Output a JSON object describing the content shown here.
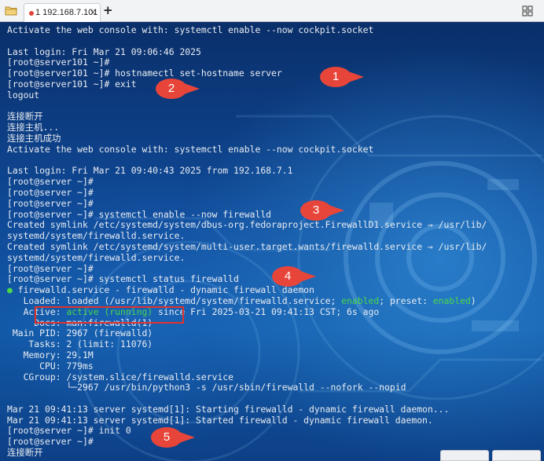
{
  "tabs": [
    {
      "label": "1 192.168.7.101",
      "active": true,
      "close": "×"
    }
  ],
  "new_tab": "+",
  "colors": {
    "accent_red": "#e2322a",
    "terminal_text": "#e8ecf2",
    "status_green": "#4bd84b",
    "terminal_bg": "#0f4a98"
  },
  "icons": [
    "folder-icon",
    "tab-status-dot-icon",
    "close-icon",
    "plus-icon",
    "grid-icon",
    "status-dot-icon"
  ],
  "terminal": {
    "lines": [
      "Activate the web console with: systemctl enable --now cockpit.socket",
      "",
      "Last login: Fri Mar 21 09:06:46 2025",
      "[root@server101 ~]#",
      "[root@server101 ~]# hostnamectl set-hostname server",
      "[root@server101 ~]# exit",
      "logout",
      "",
      "连接断开",
      "连接主机...",
      "连接主机成功",
      "Activate the web console with: systemctl enable --now cockpit.socket",
      "",
      "Last login: Fri Mar 21 09:40:43 2025 from 192.168.7.1",
      "[root@server ~]#",
      "[root@server ~]#",
      "[root@server ~]#",
      "[root@server ~]# systemctl enable --now firewalld",
      "Created symlink /etc/systemd/system/dbus-org.fedoraproject.FirewallD1.service → /usr/lib/",
      "systemd/system/firewalld.service.",
      "Created symlink /etc/systemd/system/multi-user.target.wants/firewalld.service → /usr/lib/",
      "systemd/system/firewalld.service.",
      "[root@server ~]#",
      "[root@server ~]# systemctl status firewalld"
    ],
    "status_title": "firewalld.service - firewalld - dynamic firewall daemon",
    "status_bullet": "●",
    "loaded_prefix": "   Loaded: loaded (/usr/lib/systemd/system/firewalld.service; ",
    "loaded_enabled1": "enabled",
    "loaded_mid": "; preset: ",
    "loaded_enabled2": "enabled",
    "loaded_suffix": ")",
    "active_prefix": "   Active: ",
    "active_value": "active (running)",
    "active_suffix": " since Fri 2025-03-21 09:41:13 CST; 6s ago",
    "details": [
      "     Docs: man:firewalld(1)",
      " Main PID: 2967 (firewalld)",
      "    Tasks: 2 (limit: 11076)",
      "   Memory: 29.1M",
      "      CPU: 779ms",
      "   CGroup: /system.slice/firewalld.service",
      "           └─2967 /usr/bin/python3 -s /usr/sbin/firewalld --nofork --nopid"
    ],
    "tail": [
      "",
      "Mar 21 09:41:13 server systemd[1]: Starting firewalld - dynamic firewall daemon...",
      "Mar 21 09:41:13 server systemd[1]: Started firewalld - dynamic firewall daemon.",
      "[root@server ~]# init 0",
      "[root@server ~]#",
      "连接断开"
    ]
  },
  "annotations": [
    "1",
    "2",
    "3",
    "4",
    "5"
  ]
}
